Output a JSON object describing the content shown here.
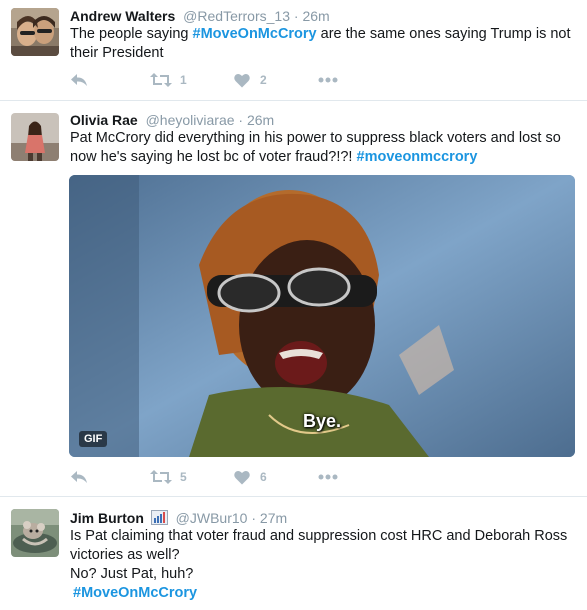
{
  "tweets": [
    {
      "name": "Andrew Walters",
      "handle": "@RedTerrors_13",
      "dot": "·",
      "time": "26m",
      "text_before": "The people saying ",
      "hashtag": "#MoveOnMcCrory",
      "text_after": " are the same ones saying Trump is not their President",
      "retweets": "1",
      "likes": "2"
    },
    {
      "name": "Olivia Rae",
      "handle": "@heyoliviarae",
      "dot": "·",
      "time": "26m",
      "text_before": "Pat McCrory did everything in his power to suppress black voters and lost so now he's saying he lost bc of voter fraud?!?! ",
      "hashtag": "#moveonmccrory",
      "gif_badge": "GIF",
      "gif_caption": "Bye.",
      "retweets": "5",
      "likes": "6"
    },
    {
      "name": "Jim Burton",
      "handle": "@JWBur10",
      "dot": "·",
      "time": "27m",
      "line1": "Is Pat claiming that voter fraud and suppression cost HRC and Deborah Ross victories as well?",
      "line2": "No? Just Pat, huh?",
      "hashtag": "#MoveOnMcCrory"
    }
  ],
  "colors": {
    "hashtag": "#1b95e0",
    "meta": "#8899a6",
    "action": "#aab8c2",
    "divider": "#e1e8ed"
  },
  "icons": [
    "reply-icon",
    "retweet-icon",
    "heart-icon",
    "more-icon",
    "bar-chart-icon"
  ]
}
